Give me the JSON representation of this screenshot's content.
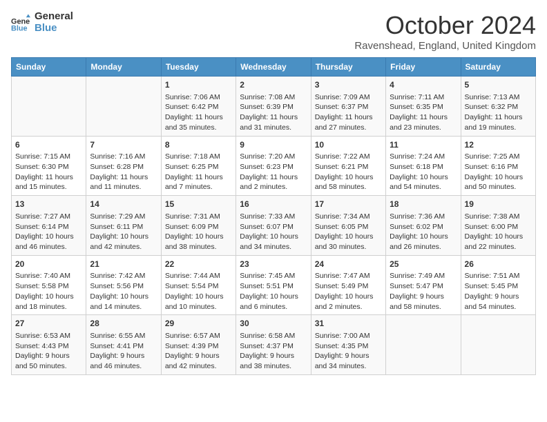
{
  "header": {
    "logo_general": "General",
    "logo_blue": "Blue",
    "month_title": "October 2024",
    "subtitle": "Ravenshead, England, United Kingdom"
  },
  "weekdays": [
    "Sunday",
    "Monday",
    "Tuesday",
    "Wednesday",
    "Thursday",
    "Friday",
    "Saturday"
  ],
  "rows": [
    [
      {
        "day": "",
        "info": ""
      },
      {
        "day": "",
        "info": ""
      },
      {
        "day": "1",
        "info": "Sunrise: 7:06 AM\nSunset: 6:42 PM\nDaylight: 11 hours and 35 minutes."
      },
      {
        "day": "2",
        "info": "Sunrise: 7:08 AM\nSunset: 6:39 PM\nDaylight: 11 hours and 31 minutes."
      },
      {
        "day": "3",
        "info": "Sunrise: 7:09 AM\nSunset: 6:37 PM\nDaylight: 11 hours and 27 minutes."
      },
      {
        "day": "4",
        "info": "Sunrise: 7:11 AM\nSunset: 6:35 PM\nDaylight: 11 hours and 23 minutes."
      },
      {
        "day": "5",
        "info": "Sunrise: 7:13 AM\nSunset: 6:32 PM\nDaylight: 11 hours and 19 minutes."
      }
    ],
    [
      {
        "day": "6",
        "info": "Sunrise: 7:15 AM\nSunset: 6:30 PM\nDaylight: 11 hours and 15 minutes."
      },
      {
        "day": "7",
        "info": "Sunrise: 7:16 AM\nSunset: 6:28 PM\nDaylight: 11 hours and 11 minutes."
      },
      {
        "day": "8",
        "info": "Sunrise: 7:18 AM\nSunset: 6:25 PM\nDaylight: 11 hours and 7 minutes."
      },
      {
        "day": "9",
        "info": "Sunrise: 7:20 AM\nSunset: 6:23 PM\nDaylight: 11 hours and 2 minutes."
      },
      {
        "day": "10",
        "info": "Sunrise: 7:22 AM\nSunset: 6:21 PM\nDaylight: 10 hours and 58 minutes."
      },
      {
        "day": "11",
        "info": "Sunrise: 7:24 AM\nSunset: 6:18 PM\nDaylight: 10 hours and 54 minutes."
      },
      {
        "day": "12",
        "info": "Sunrise: 7:25 AM\nSunset: 6:16 PM\nDaylight: 10 hours and 50 minutes."
      }
    ],
    [
      {
        "day": "13",
        "info": "Sunrise: 7:27 AM\nSunset: 6:14 PM\nDaylight: 10 hours and 46 minutes."
      },
      {
        "day": "14",
        "info": "Sunrise: 7:29 AM\nSunset: 6:11 PM\nDaylight: 10 hours and 42 minutes."
      },
      {
        "day": "15",
        "info": "Sunrise: 7:31 AM\nSunset: 6:09 PM\nDaylight: 10 hours and 38 minutes."
      },
      {
        "day": "16",
        "info": "Sunrise: 7:33 AM\nSunset: 6:07 PM\nDaylight: 10 hours and 34 minutes."
      },
      {
        "day": "17",
        "info": "Sunrise: 7:34 AM\nSunset: 6:05 PM\nDaylight: 10 hours and 30 minutes."
      },
      {
        "day": "18",
        "info": "Sunrise: 7:36 AM\nSunset: 6:02 PM\nDaylight: 10 hours and 26 minutes."
      },
      {
        "day": "19",
        "info": "Sunrise: 7:38 AM\nSunset: 6:00 PM\nDaylight: 10 hours and 22 minutes."
      }
    ],
    [
      {
        "day": "20",
        "info": "Sunrise: 7:40 AM\nSunset: 5:58 PM\nDaylight: 10 hours and 18 minutes."
      },
      {
        "day": "21",
        "info": "Sunrise: 7:42 AM\nSunset: 5:56 PM\nDaylight: 10 hours and 14 minutes."
      },
      {
        "day": "22",
        "info": "Sunrise: 7:44 AM\nSunset: 5:54 PM\nDaylight: 10 hours and 10 minutes."
      },
      {
        "day": "23",
        "info": "Sunrise: 7:45 AM\nSunset: 5:51 PM\nDaylight: 10 hours and 6 minutes."
      },
      {
        "day": "24",
        "info": "Sunrise: 7:47 AM\nSunset: 5:49 PM\nDaylight: 10 hours and 2 minutes."
      },
      {
        "day": "25",
        "info": "Sunrise: 7:49 AM\nSunset: 5:47 PM\nDaylight: 9 hours and 58 minutes."
      },
      {
        "day": "26",
        "info": "Sunrise: 7:51 AM\nSunset: 5:45 PM\nDaylight: 9 hours and 54 minutes."
      }
    ],
    [
      {
        "day": "27",
        "info": "Sunrise: 6:53 AM\nSunset: 4:43 PM\nDaylight: 9 hours and 50 minutes."
      },
      {
        "day": "28",
        "info": "Sunrise: 6:55 AM\nSunset: 4:41 PM\nDaylight: 9 hours and 46 minutes."
      },
      {
        "day": "29",
        "info": "Sunrise: 6:57 AM\nSunset: 4:39 PM\nDaylight: 9 hours and 42 minutes."
      },
      {
        "day": "30",
        "info": "Sunrise: 6:58 AM\nSunset: 4:37 PM\nDaylight: 9 hours and 38 minutes."
      },
      {
        "day": "31",
        "info": "Sunrise: 7:00 AM\nSunset: 4:35 PM\nDaylight: 9 hours and 34 minutes."
      },
      {
        "day": "",
        "info": ""
      },
      {
        "day": "",
        "info": ""
      }
    ]
  ]
}
